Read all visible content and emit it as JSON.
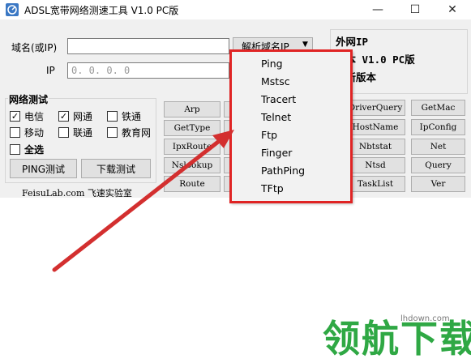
{
  "window": {
    "title": "ADSL宽带网络测速工具 V1.0 PC版",
    "minimize": "—",
    "maximize": "☐",
    "close": "✕"
  },
  "lookup": {
    "domain_label": "域名(或IP)",
    "domain_value": "",
    "resolve_button": "解析域名IP",
    "ip_label": "IP",
    "ip_value": "0. 0. 0. 0"
  },
  "network_test": {
    "title": "网络测试",
    "checkboxes": [
      {
        "label": "电信",
        "checked": true
      },
      {
        "label": "网通",
        "checked": true
      },
      {
        "label": "铁通",
        "checked": false
      },
      {
        "label": "移动",
        "checked": false
      },
      {
        "label": "联通",
        "checked": false
      },
      {
        "label": "教育网",
        "checked": false
      }
    ],
    "select_all": {
      "label": "全选",
      "checked": false
    },
    "ping_button": "PING测试",
    "download_button": "下载测试"
  },
  "footer_text": "FeisuLab.com 飞速实验室",
  "tools_left": [
    "Arp",
    "GetType",
    "IpxRoute",
    "Nslookup",
    "Route"
  ],
  "tools_right_col1": [
    "DriverQuery",
    "HostName",
    "Nbtstat",
    "Ntsd",
    "TaskList"
  ],
  "tools_right_col2": [
    "GetMac",
    "IpConfig",
    "Net",
    "Query",
    "Ver"
  ],
  "right_panel": {
    "line1": "外网IP",
    "line2": "版本 V1.0 PC版",
    "line3": "最新版本"
  },
  "dropdown_menu": [
    "Ping",
    "Mstsc",
    "Tracert",
    "Telnet",
    "Ftp",
    "Finger",
    "PathPing",
    "TFtp"
  ],
  "watermark": {
    "url": "lhdown.com",
    "text": "领航下载"
  },
  "colors": {
    "highlight": "#e02424",
    "arrow": "#d32f2f",
    "watermark": "#2fa844"
  }
}
